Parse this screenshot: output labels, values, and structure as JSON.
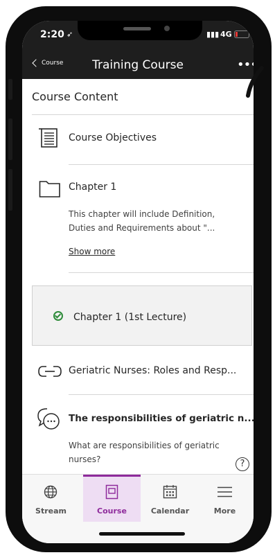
{
  "status": {
    "time": "2:20",
    "network": "4G"
  },
  "nav": {
    "back_label": "Course",
    "title": "Training Course",
    "more_icon": "more-horizontal-icon"
  },
  "content": {
    "section_title": "Course Content",
    "items": [
      {
        "title": "Course Objectives",
        "icon": "document-icon"
      },
      {
        "title": "Chapter 1",
        "icon": "folder-icon",
        "description": "This chapter will include Definition, Duties and Requirements about \"...",
        "show_more": "Show more"
      },
      {
        "title": "Chapter 1 (1st Lecture)",
        "icon": "check-circle-icon"
      },
      {
        "title": "Geriatric Nurses: Roles and Resp...",
        "icon": "link-icon"
      },
      {
        "title": "The responsibilities of geriatric n...",
        "icon": "discussion-icon",
        "description": "What are responsibilities of geriatric nurses?"
      }
    ]
  },
  "tabs": [
    {
      "label": "Stream",
      "icon": "globe-icon"
    },
    {
      "label": "Course",
      "icon": "course-icon"
    },
    {
      "label": "Calendar",
      "icon": "calendar-icon"
    },
    {
      "label": "More",
      "icon": "menu-icon"
    }
  ],
  "colors": {
    "accent": "#8e2a9b",
    "header": "#1e1e1e",
    "success": "#2e8b3a"
  }
}
